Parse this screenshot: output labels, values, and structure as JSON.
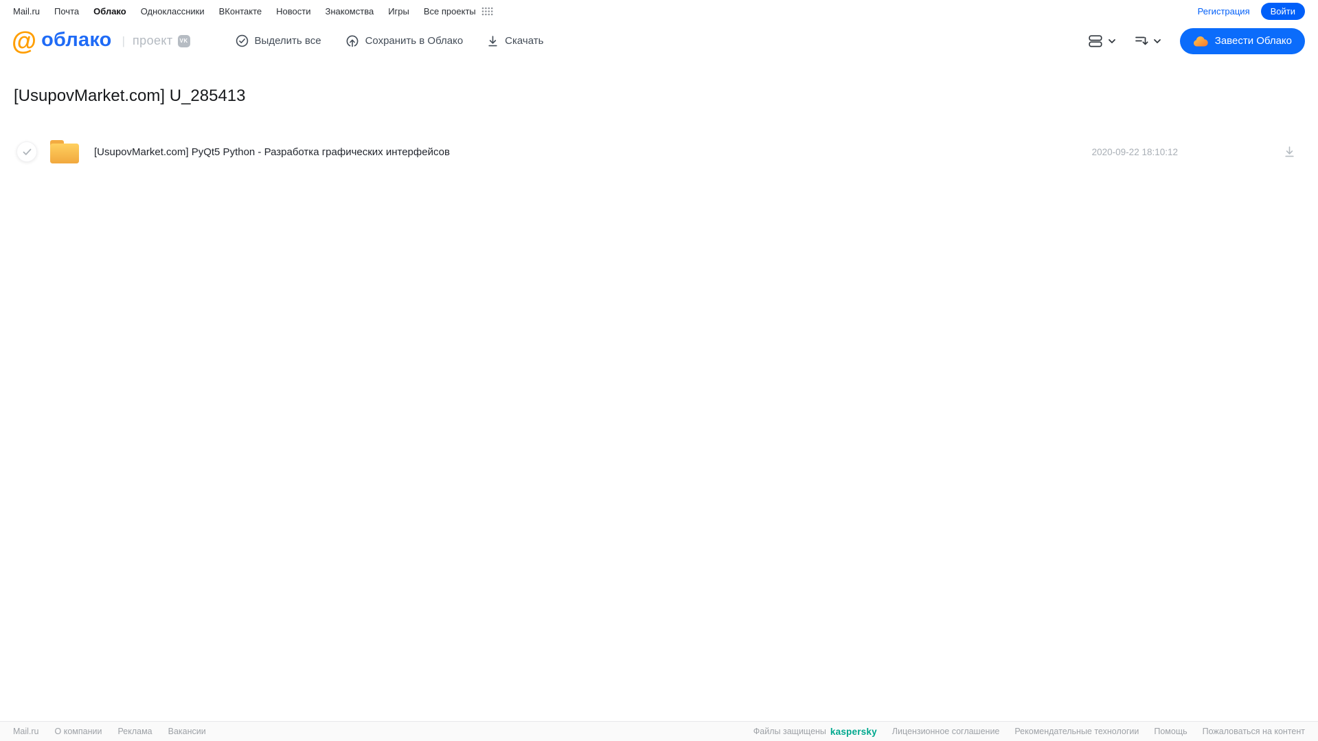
{
  "portal_nav": {
    "items": [
      {
        "label": "Mail.ru"
      },
      {
        "label": "Почта"
      },
      {
        "label": "Облако",
        "active": true
      },
      {
        "label": "Одноклассники"
      },
      {
        "label": "ВКонтакте"
      },
      {
        "label": "Новости"
      },
      {
        "label": "Знакомства"
      },
      {
        "label": "Игры"
      },
      {
        "label": "Все проекты"
      }
    ],
    "registration_label": "Регистрация",
    "login_label": "Войти"
  },
  "header": {
    "logo_at": "@",
    "logo_text": "облако",
    "project_label": "проект",
    "vk_badge_label": "VK",
    "toolbar": {
      "select_all_label": "Выделить все",
      "save_to_cloud_label": "Сохранить в Облако",
      "download_label": "Скачать"
    },
    "get_cloud_label": "Завести Облако"
  },
  "main": {
    "title": "[UsupovMarket.com] U_285413",
    "files": [
      {
        "type": "folder",
        "name": "[UsupovMarket.com] PyQt5 Python - Разработка графических интерфейсов",
        "date": "2020-09-22 18:10:12"
      }
    ]
  },
  "footer": {
    "left_links": [
      "Mail.ru",
      "О компании",
      "Реклама",
      "Вакансии"
    ],
    "protected_label": "Файлы защищены",
    "kaspersky_label": "kaspersky",
    "right_links": [
      "Лицензионное соглашение",
      "Рекомендательные технологии",
      "Помощь",
      "Пожаловаться на контент"
    ]
  },
  "icons": {
    "apps_grid": "3x4 dot grid",
    "select_all": "check in circle",
    "save_to_cloud": "circle with up arrow",
    "download": "down arrow with baseline",
    "view_mode": "two stacked rounded rectangles + chevron",
    "sort": "lines with down arrow + chevron",
    "cloud": "orange cloud",
    "folder": "yellow folder",
    "row_check": "gray checkmark"
  },
  "colors": {
    "accent_blue": "#005ff9",
    "button_blue": "#0b6cfb",
    "logo_orange": "#ff9e00",
    "logo_blue": "#1f6bf6",
    "folder_top": "#ffd05f",
    "folder_bottom": "#f1a83e",
    "kaspersky_green": "#00a88e",
    "muted_gray": "#9da1a6"
  }
}
